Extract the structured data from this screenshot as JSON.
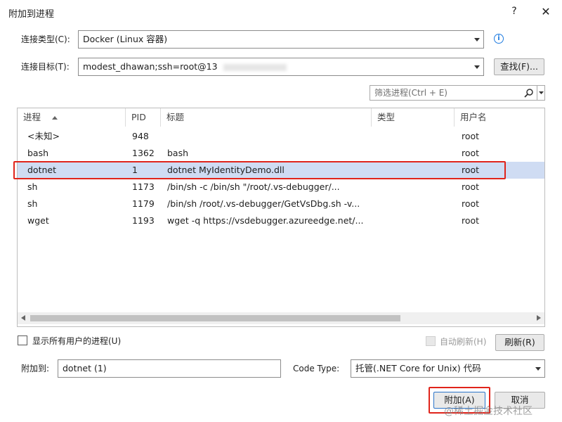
{
  "dialog": {
    "title": "附加到进程",
    "help": "?",
    "close": "✕"
  },
  "connection_type": {
    "label": "连接类型(C):",
    "value": "Docker (Linux 容器)"
  },
  "connection_target": {
    "label": "连接目标(T):",
    "value": "modest_dhawan;ssh=root@13",
    "find_button": "查找(F)..."
  },
  "filter": {
    "placeholder": "筛选进程(Ctrl + E)"
  },
  "table": {
    "columns": [
      "进程",
      "PID",
      "标题",
      "类型",
      "用户名"
    ],
    "rows": [
      {
        "process": "<未知>",
        "pid": "948",
        "title": "",
        "type": "",
        "user": "root"
      },
      {
        "process": "bash",
        "pid": "1362",
        "title": "bash",
        "type": "",
        "user": "root"
      },
      {
        "process": "dotnet",
        "pid": "1",
        "title": "dotnet MyIdentityDemo.dll",
        "type": "",
        "user": "root"
      },
      {
        "process": "sh",
        "pid": "1173",
        "title": "/bin/sh -c /bin/sh \"/root/.vs-debugger/...",
        "type": "",
        "user": "root"
      },
      {
        "process": "sh",
        "pid": "1179",
        "title": "/bin/sh /root/.vs-debugger/GetVsDbg.sh -v...",
        "type": "",
        "user": "root"
      },
      {
        "process": "wget",
        "pid": "1193",
        "title": "wget -q https://vsdebugger.azureedge.net/...",
        "type": "",
        "user": "root"
      }
    ],
    "selected_index": 2
  },
  "options": {
    "show_all_users": "显示所有用户的进程(U)",
    "auto_refresh": "自动刷新(H)",
    "refresh_button": "刷新(R)"
  },
  "attach_to": {
    "label": "附加到:",
    "value": "dotnet (1)"
  },
  "code_type": {
    "label": "Code Type:",
    "value": "托管(.NET Core for Unix) 代码"
  },
  "actions": {
    "attach": "附加(A)",
    "cancel": "取消"
  },
  "watermark": "@稀土掘金技术社区",
  "colors": {
    "highlight_red": "#e0241b",
    "selected_row": "#cfdcf3",
    "info_blue": "#1e7be0"
  }
}
